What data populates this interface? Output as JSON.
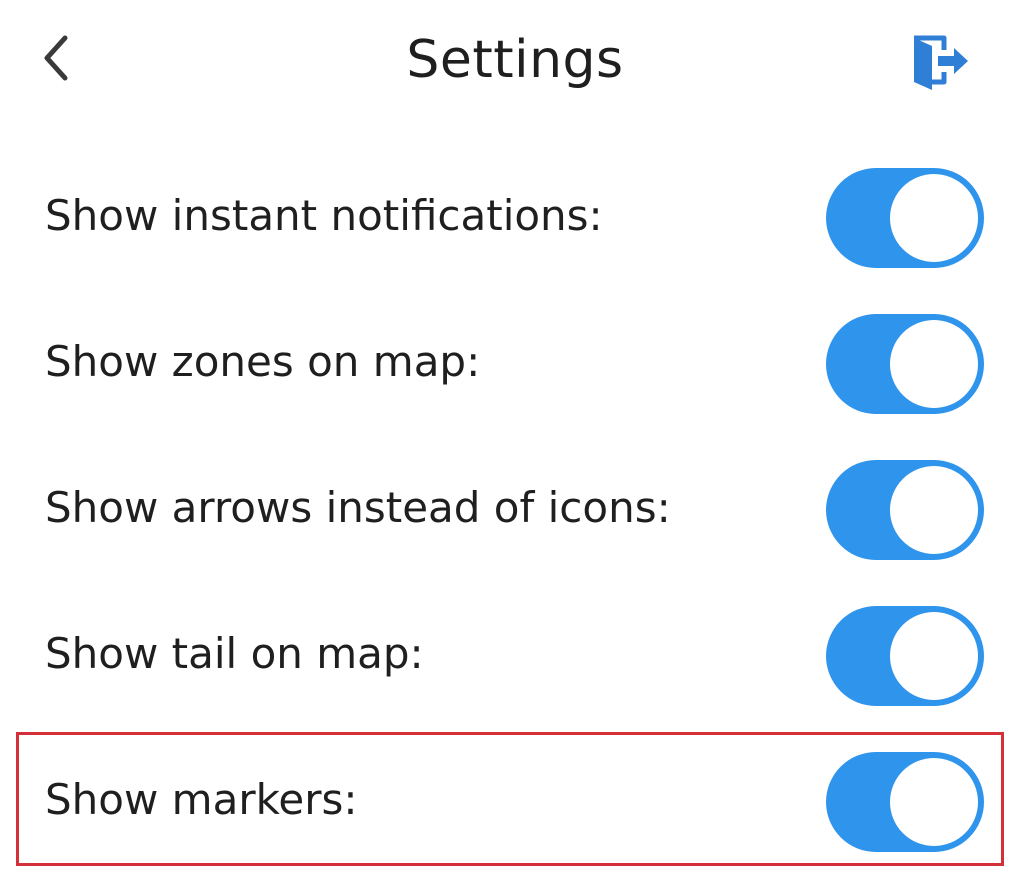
{
  "header": {
    "title": "Settings"
  },
  "colors": {
    "accent": "#2f95ec",
    "highlight": "#d3303a",
    "text": "#1f1f1f"
  },
  "settings": {
    "items": [
      {
        "label": "Show instant notifications:",
        "enabled": true
      },
      {
        "label": "Show zones on map:",
        "enabled": true
      },
      {
        "label": "Show arrows instead of icons:",
        "enabled": true
      },
      {
        "label": "Show tail on map:",
        "enabled": true
      },
      {
        "label": "Show markers:",
        "enabled": true
      }
    ]
  }
}
